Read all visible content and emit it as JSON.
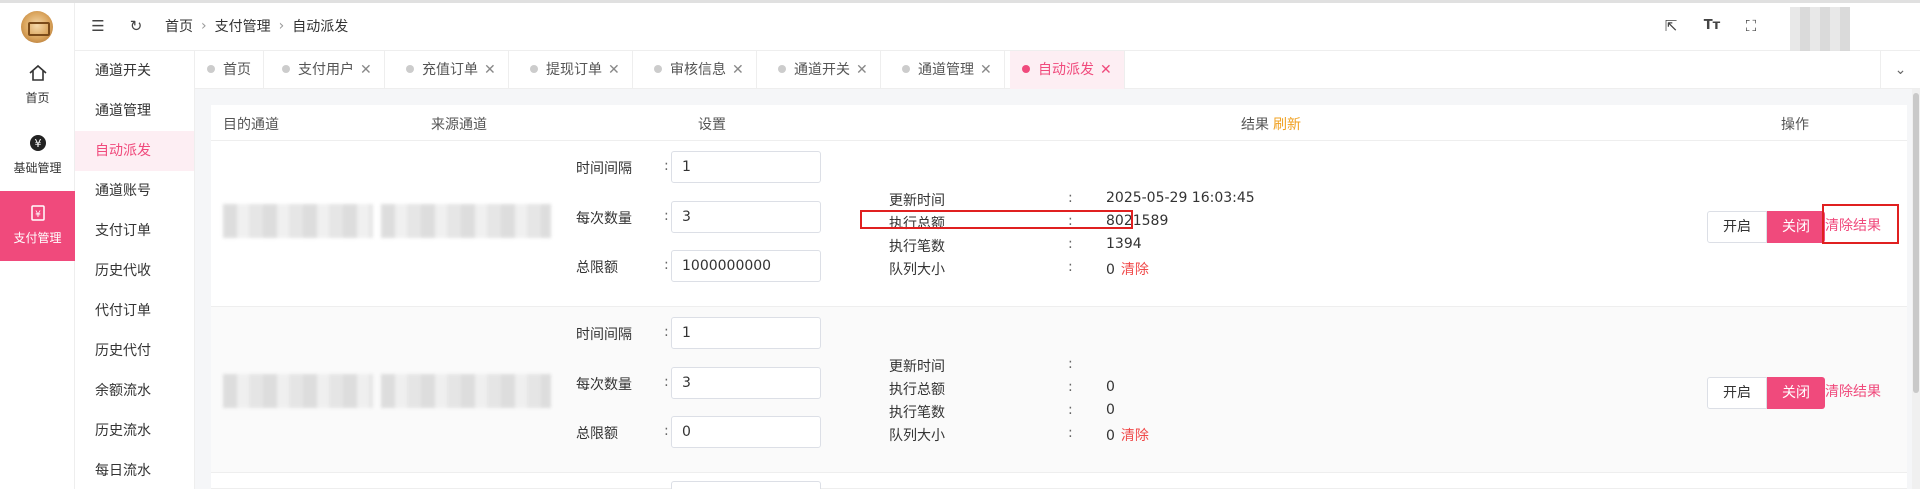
{
  "rail": {
    "items": [
      {
        "label": "首页",
        "icon": "home-icon",
        "active": false
      },
      {
        "label": "基础管理",
        "icon": "yen-icon",
        "active": false
      },
      {
        "label": "支付管理",
        "icon": "payment-icon",
        "active": true
      }
    ]
  },
  "submenu": {
    "items": [
      "通道开关",
      "通道管理",
      "自动派发",
      "通道账号",
      "支付订单",
      "历史代收",
      "代付订单",
      "历史代付",
      "余额流水",
      "历史流水",
      "每日流水"
    ],
    "active_index": 2
  },
  "header": {
    "breadcrumb": [
      "首页",
      "支付管理",
      "自动派发"
    ]
  },
  "tabs": [
    {
      "label": "首页",
      "closable": false,
      "active": false
    },
    {
      "label": "支付用户",
      "closable": true,
      "active": false
    },
    {
      "label": "充值订单",
      "closable": true,
      "active": false
    },
    {
      "label": "提现订单",
      "closable": true,
      "active": false
    },
    {
      "label": "审核信息",
      "closable": true,
      "active": false
    },
    {
      "label": "通道开关",
      "closable": true,
      "active": false
    },
    {
      "label": "通道管理",
      "closable": true,
      "active": false
    },
    {
      "label": "自动派发",
      "closable": true,
      "active": true
    }
  ],
  "table": {
    "headers": {
      "target": "目的通道",
      "source": "来源通道",
      "settings": "设置",
      "result": "结果",
      "refresh": "刷新",
      "actions": "操作"
    },
    "rows": [
      {
        "settings": [
          {
            "label": "时间间隔",
            "value": "1"
          },
          {
            "label": "每次数量",
            "value": "3"
          },
          {
            "label": "总限额",
            "value": "1000000000"
          }
        ],
        "results": [
          {
            "label": "更新时间",
            "value": "2025-05-29 16:03:45"
          },
          {
            "label": "执行总额",
            "value": "8021589"
          },
          {
            "label": "执行笔数",
            "value": "1394"
          },
          {
            "label": "队列大小",
            "value": "0",
            "clear": "清除"
          }
        ],
        "open_label": "开启",
        "close_label": "关闭",
        "clear_result_label": "清除结果"
      },
      {
        "settings": [
          {
            "label": "时间间隔",
            "value": "1"
          },
          {
            "label": "每次数量",
            "value": "3"
          },
          {
            "label": "总限额",
            "value": "0"
          }
        ],
        "results": [
          {
            "label": "更新时间",
            "value": ""
          },
          {
            "label": "执行总额",
            "value": "0"
          },
          {
            "label": "执行笔数",
            "value": "0"
          },
          {
            "label": "队列大小",
            "value": "0",
            "clear": "清除"
          }
        ],
        "open_label": "开启",
        "close_label": "关闭",
        "clear_result_label": "清除结果"
      }
    ]
  },
  "colors": {
    "accent": "#f04a7c",
    "refresh": "#f0a020",
    "clear": "#f04a4a",
    "highlight": "#e02020"
  }
}
